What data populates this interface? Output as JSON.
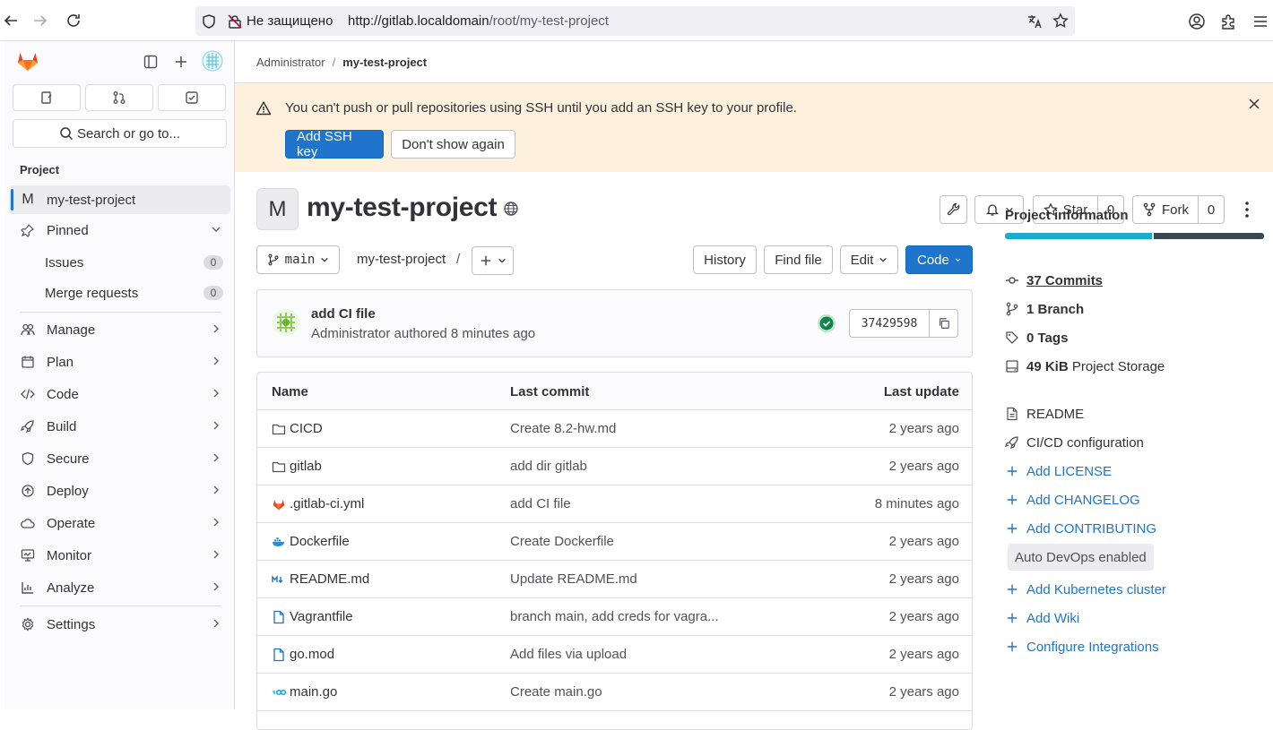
{
  "browser": {
    "insecure_label": "Не защищено",
    "url_host": "http://gitlab.localdomain",
    "url_path": "/root/my-test-project"
  },
  "sidebar": {
    "search_label": "Search or go to...",
    "section_label": "Project",
    "project_initial": "M",
    "project_name": "my-test-project",
    "pinned_label": "Pinned",
    "pinned_items": [
      {
        "label": "Issues",
        "count": "0"
      },
      {
        "label": "Merge requests",
        "count": "0"
      }
    ],
    "nav_items": [
      {
        "label": "Manage",
        "icon": "users-icon"
      },
      {
        "label": "Plan",
        "icon": "calendar-icon"
      },
      {
        "label": "Code",
        "icon": "code-icon"
      },
      {
        "label": "Build",
        "icon": "rocket-icon"
      },
      {
        "label": "Secure",
        "icon": "shield-icon"
      },
      {
        "label": "Deploy",
        "icon": "deploy-icon"
      },
      {
        "label": "Operate",
        "icon": "cloud-icon"
      },
      {
        "label": "Monitor",
        "icon": "monitor-icon"
      },
      {
        "label": "Analyze",
        "icon": "chart-icon"
      }
    ],
    "settings_label": "Settings"
  },
  "breadcrumb": {
    "parent": "Administrator",
    "separator": "/",
    "current": "my-test-project"
  },
  "alert": {
    "message": "You can't push or pull repositories using SSH until you add an SSH key to your profile.",
    "add_key_label": "Add SSH key",
    "dismiss_label": "Don't show again"
  },
  "project": {
    "initial": "M",
    "title": "my-test-project",
    "star_label": "Star",
    "star_count": "0",
    "fork_label": "Fork",
    "fork_count": "0"
  },
  "repo_nav": {
    "branch": "main",
    "path": "my-test-project",
    "path_sep": "/",
    "history_label": "History",
    "find_file_label": "Find file",
    "edit_label": "Edit",
    "code_label": "Code"
  },
  "last_commit": {
    "title": "add CI file",
    "author": "Administrator",
    "authored_text": "authored",
    "time": "8 minutes ago",
    "sha": "37429598"
  },
  "files": {
    "headers": {
      "name": "Name",
      "last_commit": "Last commit",
      "last_update": "Last update"
    },
    "rows": [
      {
        "name": "CICD",
        "icon": "folder-icon",
        "commit": "Create 8.2-hw.md",
        "date": "2 years ago"
      },
      {
        "name": "gitlab",
        "icon": "folder-icon",
        "commit": "add dir gitlab",
        "date": "2 years ago"
      },
      {
        "name": ".gitlab-ci.yml",
        "icon": "gitlab-icon",
        "commit": "add CI file",
        "date": "8 minutes ago"
      },
      {
        "name": "Dockerfile",
        "icon": "docker-icon",
        "commit": "Create Dockerfile",
        "date": "2 years ago"
      },
      {
        "name": "README.md",
        "icon": "markdown-icon",
        "commit": "Update README.md",
        "date": "2 years ago"
      },
      {
        "name": "Vagrantfile",
        "icon": "file-icon",
        "commit": "branch main, add creds for vagra...",
        "date": "2 years ago"
      },
      {
        "name": "go.mod",
        "icon": "file-icon",
        "commit": "Add files via upload",
        "date": "2 years ago"
      },
      {
        "name": "main.go",
        "icon": "go-icon",
        "commit": "Create main.go",
        "date": "2 years ago"
      }
    ]
  },
  "project_info": {
    "title": "Project information",
    "commits": "37 Commits",
    "branches": "1 Branch",
    "tags": "0 Tags",
    "storage_size": "49 KiB",
    "storage_label": "Project Storage",
    "readme": "README",
    "cicd": "CI/CD configuration",
    "add_license": "Add LICENSE",
    "add_changelog": "Add CHANGELOG",
    "add_contributing": "Add CONTRIBUTING",
    "autodevops": "Auto DevOps enabled",
    "add_k8s": "Add Kubernetes cluster",
    "add_wiki": "Add Wiki",
    "configure_integrations": "Configure Integrations"
  },
  "colors": {
    "accent": "#1f75cb",
    "alert_bg": "#fdf1dd",
    "storage_bar_primary": "#1aaccf",
    "storage_bar_secondary": "#3a474f",
    "pipeline_success": "#108548"
  }
}
